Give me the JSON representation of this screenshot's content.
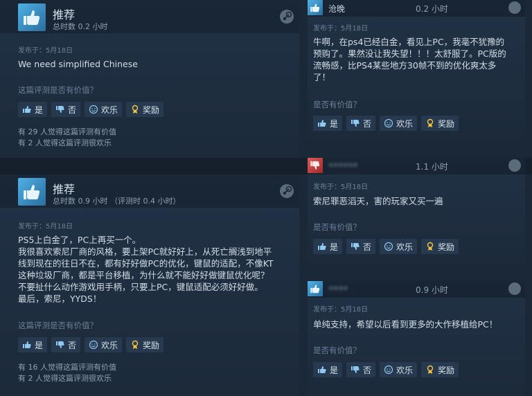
{
  "buttons": {
    "yes": "是",
    "no": "否",
    "funny": "欢乐",
    "award": "奖励"
  },
  "helpful_question": "这篇评测是否有价值？",
  "left_reviews": [
    {
      "title": "推荐",
      "hours": "总时数 0.2 小时",
      "posted": "发布于：5月18日",
      "text": "We need simplified Chinese",
      "helpful_count": "有 29 人觉得这篇评测有价值",
      "funny_count": "有 2 人觉得这篇评测很欢乐"
    },
    {
      "title": "推荐",
      "hours": "总时数 0.9 小时 （评测时 0.4 小时）",
      "posted": "发布于：5月18日",
      "text_lines": [
        "PS5上白金了，PC上再买一个。",
        "我很喜欢索尼厂商的风格，要上架PC就好好上，从死亡搁浅到地平",
        "线到现在的往日不在，都有好好做PC的优化，键鼠的适配，不像KT",
        "这种垃圾厂商，都是平台移植，为什么就不能好好做键鼠优化呢？",
        "不要扯什么动作游戏用手柄，只要上PC，键鼠适配必须好好做。",
        "最后，索尼，YYDS！"
      ],
      "helpful_count": "有 16 人觉得这篇评测有价值",
      "funny_count": "有 2 人觉得这篇评测很欢乐"
    }
  ],
  "right_reviews": [
    {
      "name": "沧晚",
      "hours": "0.2 小时",
      "posted": "发布于：5月18日",
      "text_lines": [
        "牛啊，在ps4已经白金，看见上PC，我毫不犹豫的",
        "预购了。果然没让我失望！！！太舒服了。PC版的",
        "流畅感，比PS4某些地方30帧不到的优化爽太多",
        "了！"
      ],
      "helpful_question": "是否有价值？",
      "recommended": true
    },
    {
      "name": "••••••",
      "hours": "1.1 小时",
      "posted": "发布于：5月18日",
      "text_lines": [
        "索尼罪恶滔天，害的玩家又买一遍"
      ],
      "helpful_question": "是否有价值？",
      "recommended": false
    },
    {
      "name": "••••",
      "hours": "0.9 小时",
      "posted": "发布于：5月18日",
      "text_lines": [
        "单纯支持，希望以后看到更多的大作移植给PC！"
      ],
      "helpful_question": "是否有价值？",
      "recommended": true
    }
  ],
  "colors": {
    "background": "#1b2838",
    "thumb_up": "#3d8fc9",
    "thumb_down": "#c94a4a"
  }
}
